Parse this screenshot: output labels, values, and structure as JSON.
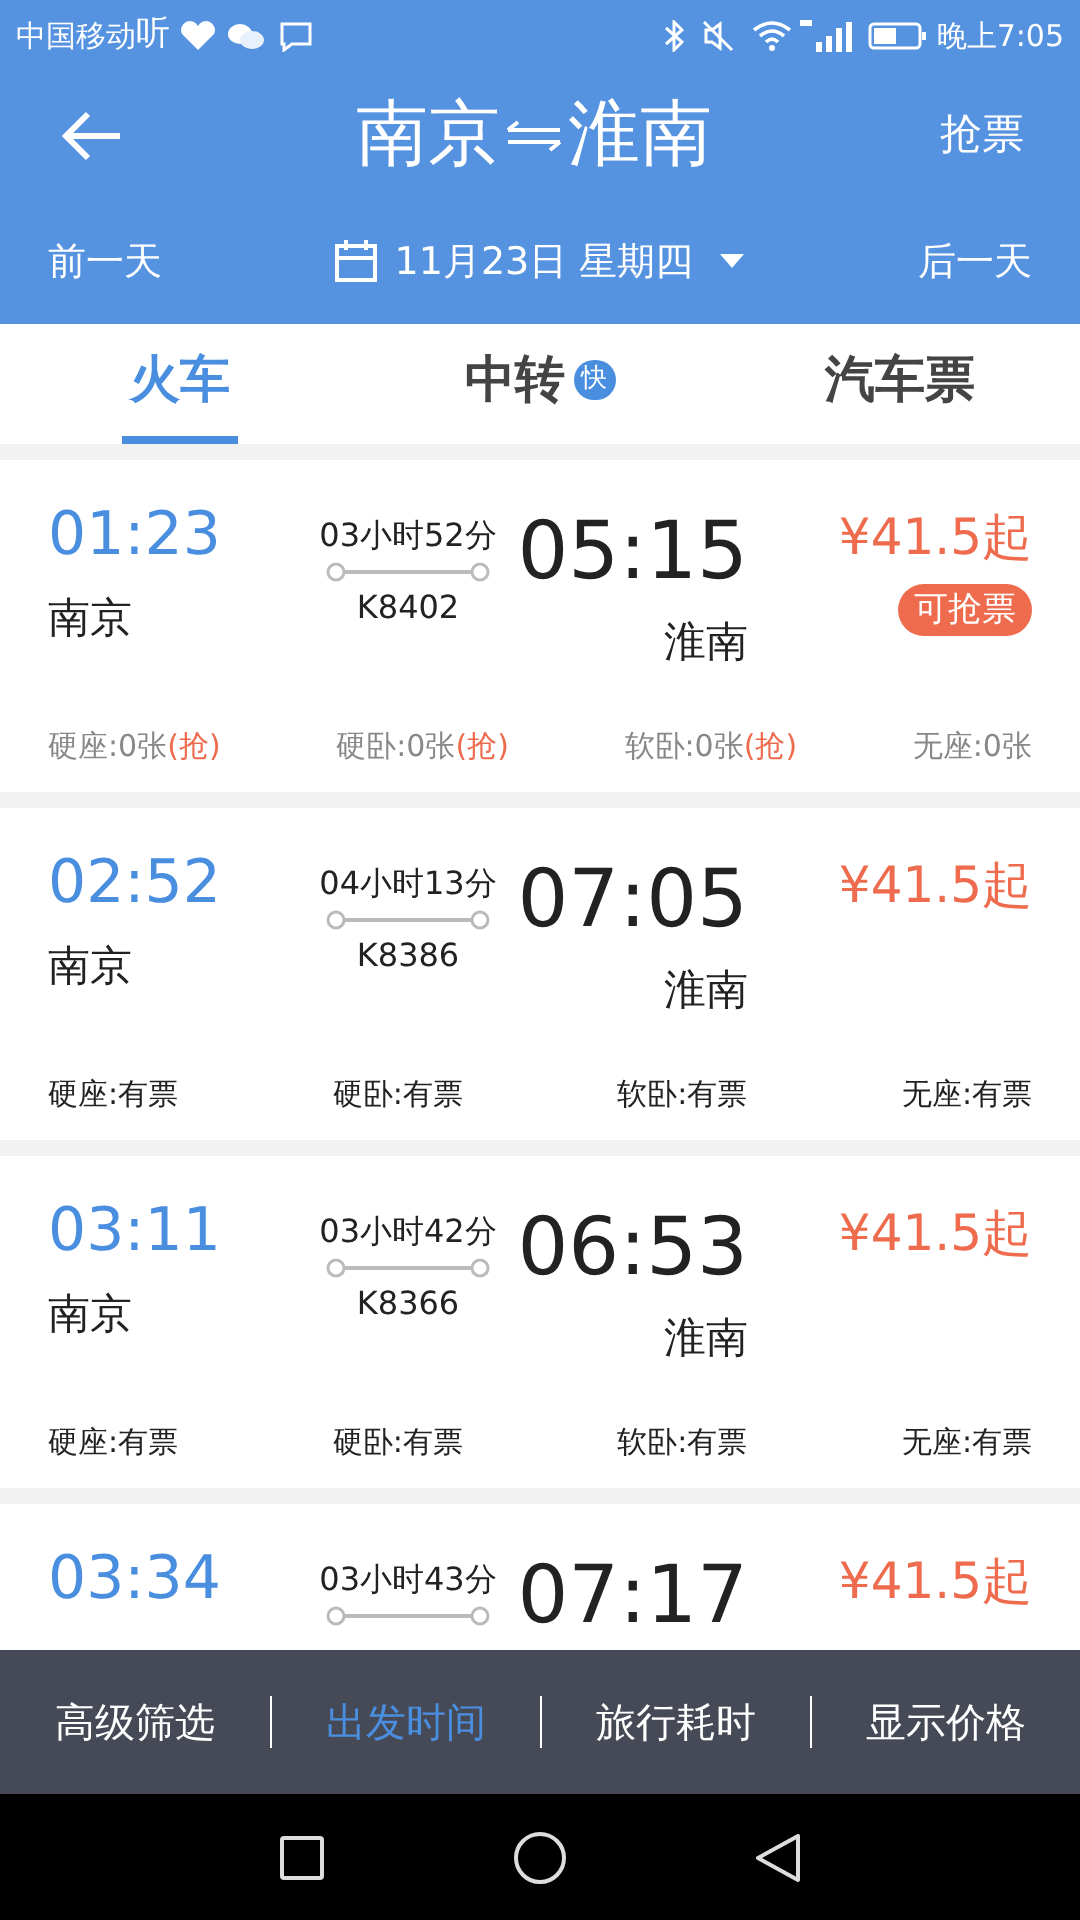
{
  "status_bar": {
    "carrier": "中国移动",
    "app_glyph": "听",
    "time": "晚上7:05"
  },
  "header": {
    "title_from": "南京",
    "title_to": "淮南",
    "action": "抢票",
    "prev_day": "前一天",
    "date": "11月23日 星期四",
    "next_day": "后一天"
  },
  "tabs": [
    {
      "label": "火车",
      "selected": true
    },
    {
      "label": "中转",
      "badge": "快",
      "selected": false
    },
    {
      "label": "汽车票",
      "selected": false
    }
  ],
  "trains": [
    {
      "depart": "01:23",
      "from": "南京",
      "duration": "03小时52分",
      "number": "K8402",
      "arrive": "05:15",
      "to": "淮南",
      "price": "¥41.5起",
      "badge": "可抢票",
      "sold_out": true,
      "seats": [
        {
          "label": "硬座:0张",
          "grab": "(抢)"
        },
        {
          "label": "硬卧:0张",
          "grab": "(抢)"
        },
        {
          "label": "软卧:0张",
          "grab": "(抢)"
        },
        {
          "label": "无座:0张"
        }
      ]
    },
    {
      "depart": "02:52",
      "from": "南京",
      "duration": "04小时13分",
      "number": "K8386",
      "arrive": "07:05",
      "to": "淮南",
      "price": "¥41.5起",
      "sold_out": false,
      "seats": [
        {
          "label": "硬座:有票"
        },
        {
          "label": "硬卧:有票"
        },
        {
          "label": "软卧:有票"
        },
        {
          "label": "无座:有票"
        }
      ]
    },
    {
      "depart": "03:11",
      "from": "南京",
      "duration": "03小时42分",
      "number": "K8366",
      "arrive": "06:53",
      "to": "淮南",
      "price": "¥41.5起",
      "sold_out": false,
      "seats": [
        {
          "label": "硬座:有票"
        },
        {
          "label": "硬卧:有票"
        },
        {
          "label": "软卧:有票"
        },
        {
          "label": "无座:有票"
        }
      ]
    },
    {
      "depart": "03:34",
      "duration": "03小时43分",
      "arrive": "07:17",
      "price": "¥41.5起"
    }
  ],
  "bottom_bar": [
    {
      "label": "高级筛选",
      "selected": false
    },
    {
      "label": "出发时间",
      "selected": true
    },
    {
      "label": "旅行耗时",
      "selected": false
    },
    {
      "label": "显示价格",
      "selected": false
    }
  ]
}
